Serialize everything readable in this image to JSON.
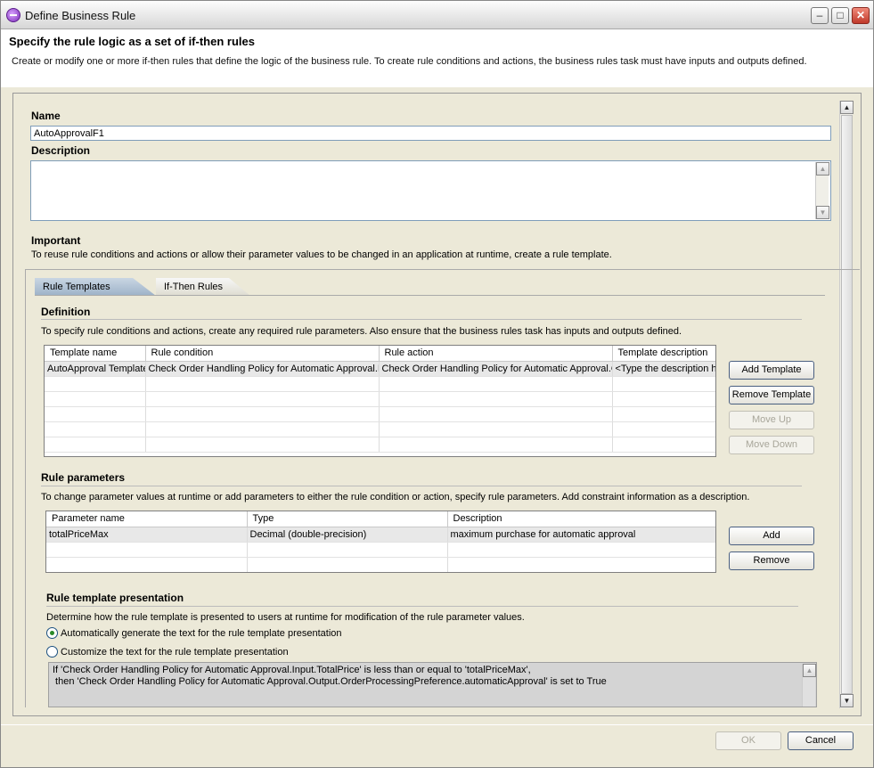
{
  "window": {
    "title": "Define Business Rule"
  },
  "header": {
    "title": "Specify the rule logic as a set of if-then rules",
    "description": "Create or modify one or more if-then rules that define the logic of the business rule. To create rule conditions and actions, the business rules task must have inputs and outputs defined."
  },
  "name": {
    "label": "Name",
    "value": "AutoApprovalF1"
  },
  "description": {
    "label": "Description",
    "value": ""
  },
  "important": {
    "label": "Important",
    "text": "To reuse rule conditions and actions or allow their parameter values to be changed in an application at runtime, create a rule template."
  },
  "tabs": [
    {
      "label": "Rule Templates"
    },
    {
      "label": "If-Then Rules"
    }
  ],
  "definition": {
    "title": "Definition",
    "text": "To specify rule conditions and actions, create any required rule parameters. Also ensure that the business rules task has inputs and outputs defined.",
    "columns": [
      "Template name",
      "Rule condition",
      "Rule action",
      "Template description"
    ],
    "rows": [
      [
        "AutoApproval Template",
        "Check Order Handling Policy for Automatic Approval.Input.TotalPrice",
        "Check Order Handling Policy for Automatic Approval.Output",
        "<Type the description here>"
      ]
    ],
    "buttons": {
      "add": "Add Template",
      "remove": "Remove Template",
      "up": "Move Up",
      "down": "Move Down"
    }
  },
  "parameters": {
    "title": "Rule parameters",
    "text": "To change parameter values at runtime or add parameters to either the rule condition or action, specify rule parameters. Add constraint information as a description.",
    "columns": [
      "Parameter name",
      "Type",
      "Description"
    ],
    "rows": [
      [
        "totalPriceMax",
        "Decimal (double-precision)",
        "maximum purchase for automatic approval"
      ]
    ],
    "buttons": {
      "add": "Add",
      "remove": "Remove"
    }
  },
  "presentation": {
    "title": "Rule template presentation",
    "text": "Determine how the rule template is presented to users at runtime for modification of the rule parameter values.",
    "option_auto": "Automatically generate the text for the rule template presentation",
    "option_custom": "Customize the text for the rule template presentation",
    "line1": "If 'Check Order Handling Policy for Automatic Approval.Input.TotalPrice' is less than or equal to 'totalPriceMax',",
    "line2": " then 'Check Order Handling Policy for Automatic Approval.Output.OrderProcessingPreference.automaticApproval' is set to True"
  },
  "footer": {
    "ok": "OK",
    "cancel": "Cancel"
  }
}
